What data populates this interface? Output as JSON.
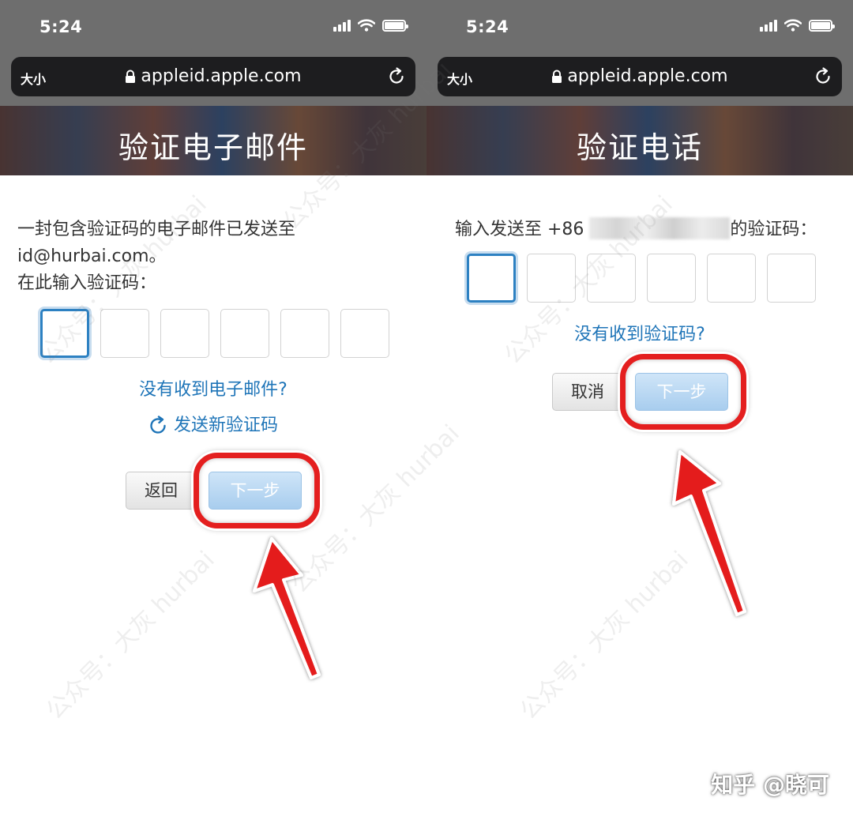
{
  "left": {
    "status": {
      "time": "5:24"
    },
    "browser": {
      "text_size": "大小",
      "url": "appleid.apple.com"
    },
    "hero_title": "验证电子邮件",
    "message_line1": "一封包含验证码的电子邮件已发送至",
    "message_line2": "id@hurbai.com。",
    "message_line3": "在此输入验证码：",
    "no_email_link": "没有收到电子邮件?",
    "resend_link": "发送新验证码",
    "back_button": "返回",
    "next_button": "下一步"
  },
  "right": {
    "status": {
      "time": "5:24"
    },
    "browser": {
      "text_size": "大小",
      "url": "appleid.apple.com"
    },
    "hero_title": "验证电话",
    "prompt_prefix": "输入发送至 +86",
    "prompt_suffix": "的验证码：",
    "no_code_link": "没有收到验证码?",
    "cancel_button": "取消",
    "next_button": "下一步"
  },
  "watermark": "公众号：大灰 hurbai",
  "credit": "知乎 @晓可",
  "colors": {
    "link": "#1f75b8",
    "highlight": "#e41f1f",
    "active_box": "#2d81c2",
    "primary_button": "#a8cdee"
  }
}
